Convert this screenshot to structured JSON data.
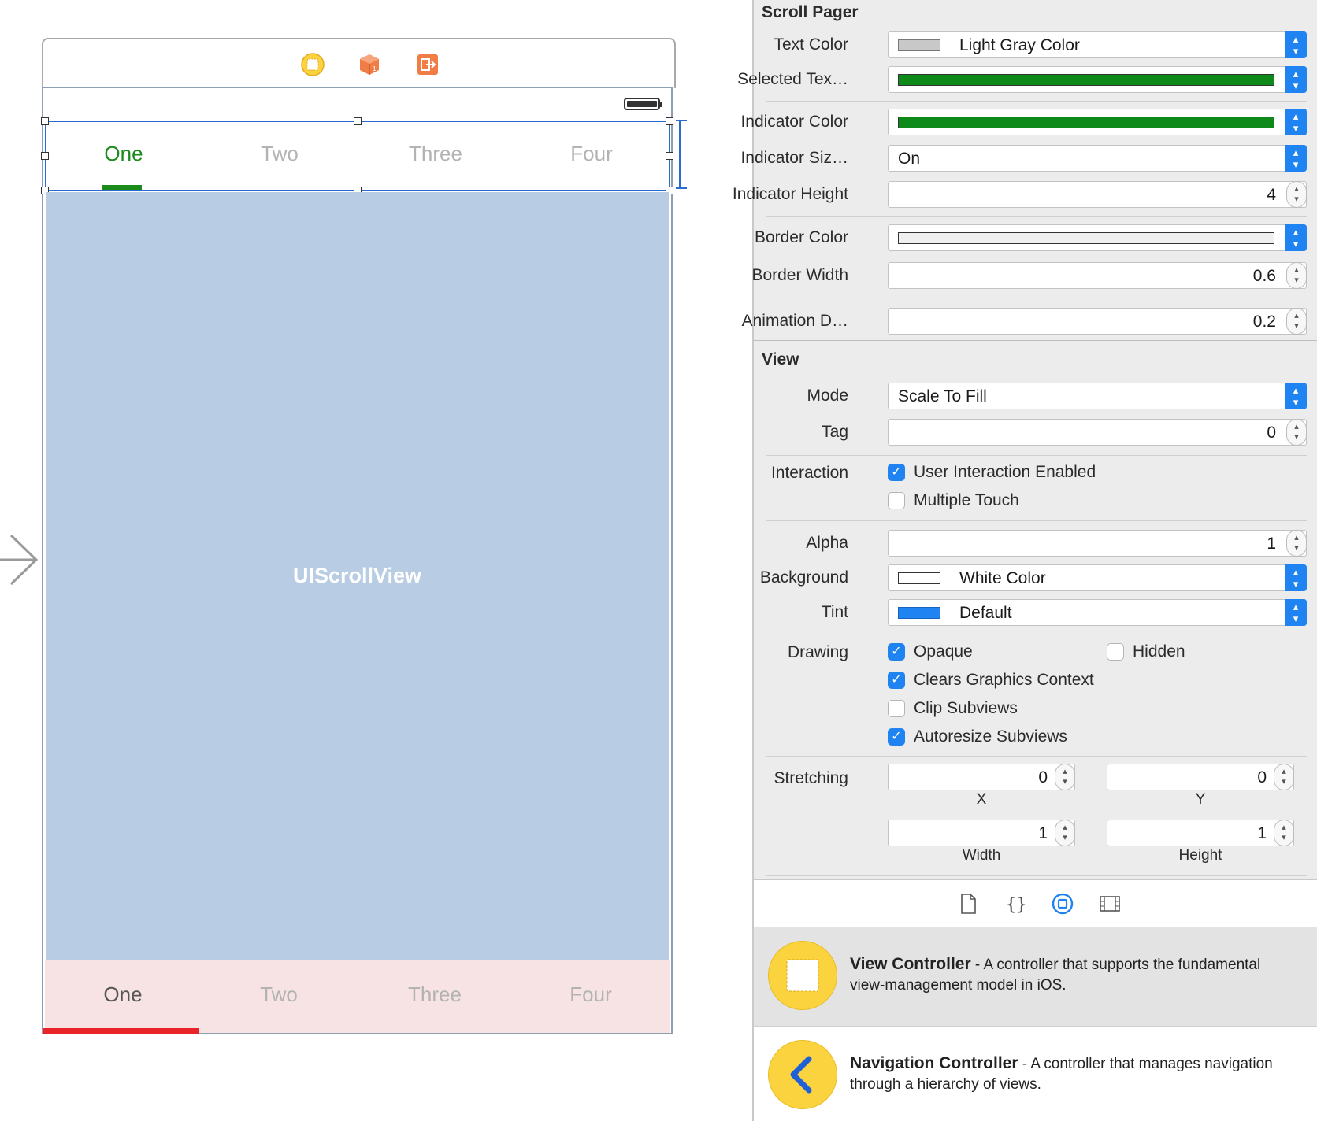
{
  "canvas": {
    "top_pager_tabs": [
      {
        "label": "One",
        "color": "#1a8a1a"
      },
      {
        "label": "Two",
        "color": "#b3b3b3"
      },
      {
        "label": "Three",
        "color": "#b3b3b3"
      },
      {
        "label": "Four",
        "color": "#b3b3b3"
      }
    ],
    "bottom_pager_tabs": [
      {
        "label": "One",
        "color": "#555555"
      },
      {
        "label": "Two",
        "color": "#b3b3b3"
      },
      {
        "label": "Three",
        "color": "#b3b3b3"
      },
      {
        "label": "Four",
        "color": "#b3b3b3"
      }
    ],
    "scroll_view_label": "UIScrollView",
    "dock_icons": [
      "view-controller-icon",
      "first-responder-icon",
      "exit-icon"
    ],
    "colors": {
      "scroll_view_bg": "#b8cce3",
      "bottom_pager_bg": "#f7e3e3",
      "selected_green": "#1a8a1a",
      "bottom_indicator": "#e8232a"
    }
  },
  "inspector": {
    "scroll_pager": {
      "title": "Scroll Pager",
      "text_color": {
        "label": "Text Color",
        "value": "Light Gray Color",
        "swatch": "#c8c8c8"
      },
      "selected_text_color": {
        "label": "Selected Tex…",
        "swatch": "#0d8a1a"
      },
      "indicator_color": {
        "label": "Indicator Color",
        "swatch": "#0d8a1a"
      },
      "indicator_size": {
        "label": "Indicator Siz…",
        "value": "On"
      },
      "indicator_height": {
        "label": "Indicator Height",
        "value": "4"
      },
      "border_color": {
        "label": "Border Color",
        "swatch": "#f0f0f0"
      },
      "border_width": {
        "label": "Border Width",
        "value": "0.6"
      },
      "animation_duration": {
        "label": "Animation D…",
        "value": "0.2"
      }
    },
    "view": {
      "title": "View",
      "mode": {
        "label": "Mode",
        "value": "Scale To Fill"
      },
      "tag": {
        "label": "Tag",
        "value": "0"
      },
      "interaction": {
        "label": "Interaction",
        "user_interaction_enabled": {
          "label": "User Interaction Enabled",
          "checked": true
        },
        "multiple_touch": {
          "label": "Multiple Touch",
          "checked": false
        }
      },
      "alpha": {
        "label": "Alpha",
        "value": "1"
      },
      "background": {
        "label": "Background",
        "value": "White Color",
        "swatch": "#ffffff"
      },
      "tint": {
        "label": "Tint",
        "value": "Default",
        "swatch": "#1f83f2"
      },
      "drawing": {
        "label": "Drawing",
        "opaque": {
          "label": "Opaque",
          "checked": true
        },
        "hidden": {
          "label": "Hidden",
          "checked": false
        },
        "clears_graphics_context": {
          "label": "Clears Graphics Context",
          "checked": true
        },
        "clip_subviews": {
          "label": "Clip Subviews",
          "checked": false
        },
        "autoresize_subviews": {
          "label": "Autoresize Subviews",
          "checked": true
        }
      },
      "stretching": {
        "label": "Stretching",
        "x": {
          "value": "0",
          "caption": "X"
        },
        "y": {
          "value": "0",
          "caption": "Y"
        },
        "width": {
          "value": "1",
          "caption": "Width"
        },
        "height": {
          "value": "1",
          "caption": "Height"
        }
      }
    },
    "library_tabs": [
      "file-icon",
      "braces-icon",
      "object-icon",
      "media-icon"
    ],
    "library": [
      {
        "name": "View Controller",
        "description": "A controller that supports the fundamental view-management model in iOS.",
        "icon": "view-controller-icon"
      },
      {
        "name": "Navigation Controller",
        "description": "A controller that manages navigation through a hierarchy of views.",
        "icon": "back-chevron-icon"
      }
    ],
    "accent": "#1f83f2"
  }
}
